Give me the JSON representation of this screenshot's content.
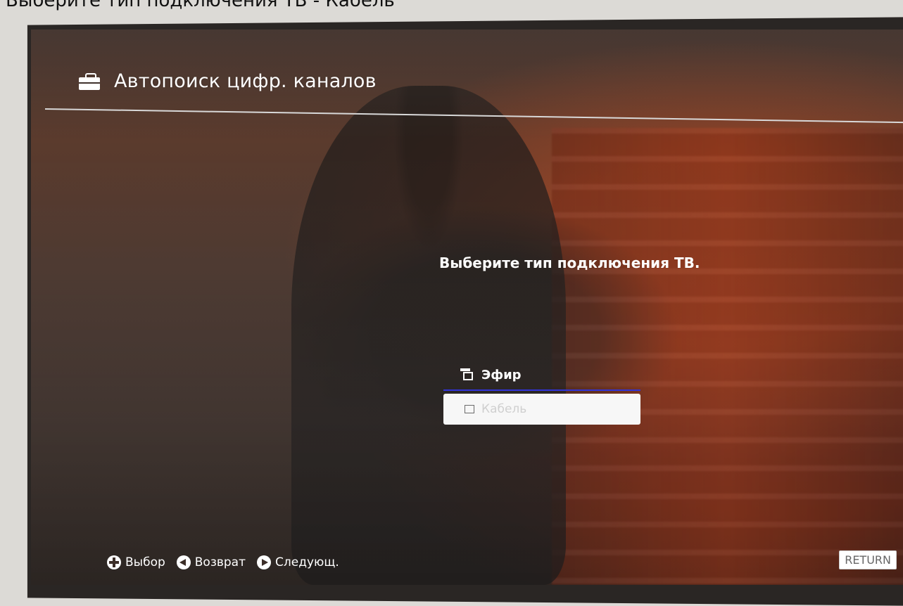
{
  "photo_caption": "Выберите тип подключения ТВ - Кабель",
  "header": {
    "title": "Автопоиск цифр. каналов",
    "icon": "briefcase-icon"
  },
  "prompt": "Выберите тип подключения ТВ.",
  "options": {
    "air": {
      "label": "Эфир",
      "icon": "air-icon",
      "selected": true
    },
    "cable": {
      "label": "Кабель",
      "icon": "cable-icon"
    }
  },
  "footer": {
    "hints": [
      {
        "label": "Выбор",
        "icon": "dpad-icon"
      },
      {
        "label": "Возврат",
        "icon": "left-arrow-icon"
      },
      {
        "label": "Следующ.",
        "icon": "right-arrow-icon"
      }
    ],
    "return_label": "RETURN"
  },
  "colors": {
    "text": "#ffffff",
    "accent": "#2b2dd7",
    "panel": "#f7f7f7"
  }
}
